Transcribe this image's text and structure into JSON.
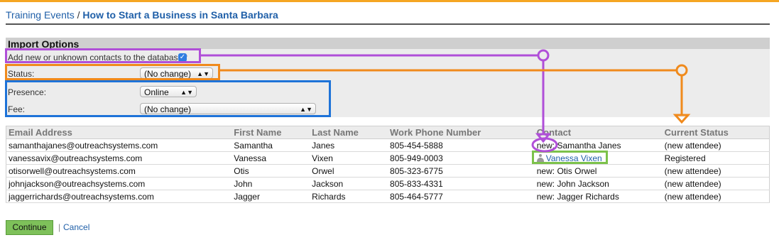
{
  "breadcrumb": {
    "parent": "Training Events",
    "separator": " / ",
    "current": "How to Start a Business in Santa Barbara"
  },
  "import_options": {
    "title": "Import Options",
    "add_contacts_label": "Add new or unknown contacts to the database?",
    "add_contacts_checked": true,
    "status_label": "Status:",
    "status_value": "(No change)",
    "presence_label": "Presence:",
    "presence_value": "Online",
    "fee_label": "Fee:",
    "fee_value": "(No change)"
  },
  "table": {
    "headers": [
      "Email Address",
      "First Name",
      "Last Name",
      "Work Phone Number",
      "Contact",
      "Current Status"
    ],
    "rows": [
      {
        "email": "samanthajanes@outreachsystems.com",
        "first": "Samantha",
        "last": "Janes",
        "phone": "805-454-5888",
        "contact_prefix": "new:",
        "contact": "Samantha Janes",
        "status": "(new attendee)"
      },
      {
        "email": "vanessavix@outreachsystems.com",
        "first": "Vanessa",
        "last": "Vixen",
        "phone": "805-949-0003",
        "contact_prefix": "",
        "contact": "Vanessa Vixen",
        "status": "Registered"
      },
      {
        "email": "otisorwell@outreachsystems.com",
        "first": "Otis",
        "last": "Orwel",
        "phone": "805-323-6775",
        "contact_prefix": "new:",
        "contact": "Otis Orwel",
        "status": "(new attendee)"
      },
      {
        "email": "johnjackson@outreachsystems.com",
        "first": "John",
        "last": "Jackson",
        "phone": "805-833-4331",
        "contact_prefix": "new:",
        "contact": "John Jackson",
        "status": "(new attendee)"
      },
      {
        "email": "jaggerrichards@outreachsystems.com",
        "first": "Jagger",
        "last": "Richards",
        "phone": "805-464-5777",
        "contact_prefix": "new:",
        "contact": "Jagger Richards",
        "status": "(new attendee)"
      }
    ]
  },
  "footer": {
    "continue_label": "Continue",
    "separator": "|",
    "cancel_label": "Cancel"
  },
  "colors": {
    "accent_orange": "#f5a623",
    "annotation_purple": "#b04fd8",
    "annotation_orange": "#f08a1c",
    "annotation_blue": "#1e73d8",
    "annotation_green": "#7cc24b",
    "link_blue": "#1f5fa8"
  },
  "icons": {
    "checkbox": "checkmark-icon",
    "select": "updown-arrows-icon",
    "contact": "person-icon"
  }
}
